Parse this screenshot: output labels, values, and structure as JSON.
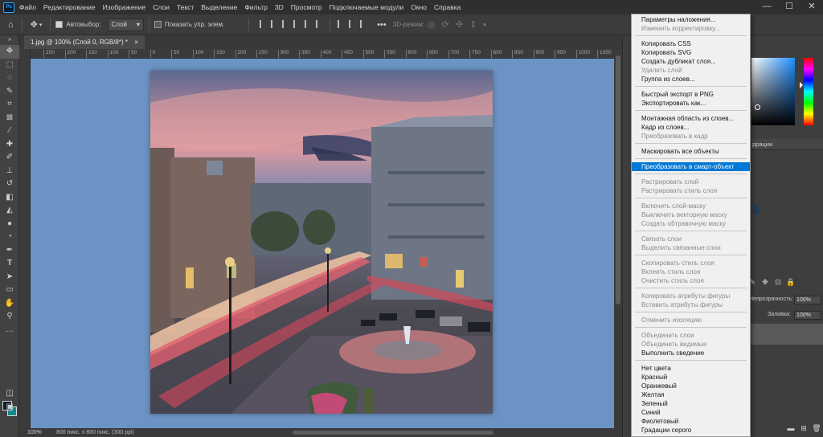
{
  "app": {
    "logo": "Ps"
  },
  "menubar": {
    "items": [
      "Файл",
      "Редактирование",
      "Изображение",
      "Слои",
      "Текст",
      "Выделение",
      "Фильтр",
      "3D",
      "Просмотр",
      "Подключаемые модули",
      "Окно",
      "Справка"
    ],
    "window_controls": [
      "—",
      "☐",
      "✕"
    ]
  },
  "options_bar": {
    "auto_select_label": "Автовыбор:",
    "auto_select_checked": true,
    "layer_select_value": "Слой",
    "show_transform_label": "Показать упр. элем.",
    "show_transform_checked": false,
    "mode_3d_label": "3D-режим:"
  },
  "document": {
    "tab_title": "1.jpg @ 100% (Слой 0, RGB/8*) *",
    "tab_close": "×",
    "ruler_ticks": [
      "250",
      "200",
      "150",
      "100",
      "50",
      "0",
      "50",
      "100",
      "150",
      "200",
      "250",
      "300",
      "350",
      "400",
      "450",
      "500",
      "550",
      "600",
      "650",
      "700",
      "750",
      "800",
      "850",
      "900",
      "950",
      "1000",
      "1050"
    ]
  },
  "status_bar": {
    "zoom": "100%",
    "doc_info": "800 пикс. x 800 пикс. (300 ppi)"
  },
  "colors": {
    "foreground": "#0b1c2e",
    "background": "#148a8a",
    "canvas_bg": "#6b93c3",
    "menu_highlight": "#0078d7"
  },
  "right_panel": {
    "tab_label": "ррации",
    "opacity_label": "Непрозрачность:",
    "opacity_value": "100%",
    "fill_label": "Заливка:",
    "fill_value": "100%"
  },
  "context_menu": {
    "groups": [
      [
        {
          "label": "Параметры наложения...",
          "enabled": true
        },
        {
          "label": "Изменить корректировку...",
          "enabled": false
        }
      ],
      [
        {
          "label": "Копировать CSS",
          "enabled": true
        },
        {
          "label": "Копировать SVG",
          "enabled": true
        },
        {
          "label": "Создать дубликат слоя...",
          "enabled": true
        },
        {
          "label": "Удалить слой",
          "enabled": false
        },
        {
          "label": "Группа из слоев...",
          "enabled": true
        }
      ],
      [
        {
          "label": "Быстрый экспорт в PNG",
          "enabled": true
        },
        {
          "label": "Экспортировать как...",
          "enabled": true
        }
      ],
      [
        {
          "label": "Монтажная область из слоев...",
          "enabled": true
        },
        {
          "label": "Кадр из слоев...",
          "enabled": true
        },
        {
          "label": "Преобразовать в кадр",
          "enabled": false
        }
      ],
      [
        {
          "label": "Маскировать все объекты",
          "enabled": true
        }
      ],
      [
        {
          "label": "Преобразовать в смарт-объект",
          "enabled": true,
          "selected": true
        }
      ],
      [
        {
          "label": "Растрировать слой",
          "enabled": false
        },
        {
          "label": "Растрировать стиль слоя",
          "enabled": false
        }
      ],
      [
        {
          "label": "Включить слой-маску",
          "enabled": false
        },
        {
          "label": "Выключить векторную маску",
          "enabled": false
        },
        {
          "label": "Создать обтравочную маску",
          "enabled": false
        }
      ],
      [
        {
          "label": "Связать слои",
          "enabled": false
        },
        {
          "label": "Выделить связанные слои",
          "enabled": false
        }
      ],
      [
        {
          "label": "Скопировать стиль слоя",
          "enabled": false
        },
        {
          "label": "Вклеить стиль слоя",
          "enabled": false
        },
        {
          "label": "Очистить стиль слоя",
          "enabled": false
        }
      ],
      [
        {
          "label": "Копировать атрибуты фигуры",
          "enabled": false
        },
        {
          "label": "Вставить атрибуты фигуры",
          "enabled": false
        }
      ],
      [
        {
          "label": "Отменить изоляцию",
          "enabled": false
        }
      ],
      [
        {
          "label": "Объединить слои",
          "enabled": false
        },
        {
          "label": "Объединить видимые",
          "enabled": false
        },
        {
          "label": "Выполнить сведение",
          "enabled": true
        }
      ],
      [
        {
          "label": "Нет цвета",
          "enabled": true
        },
        {
          "label": "Красный",
          "enabled": true
        },
        {
          "label": "Оранжевый",
          "enabled": true
        },
        {
          "label": "Желтая",
          "enabled": true
        },
        {
          "label": "Зеленый",
          "enabled": true
        },
        {
          "label": "Синий",
          "enabled": true
        },
        {
          "label": "Фиолетовый",
          "enabled": true
        },
        {
          "label": "Градации серого",
          "enabled": true
        }
      ]
    ]
  }
}
